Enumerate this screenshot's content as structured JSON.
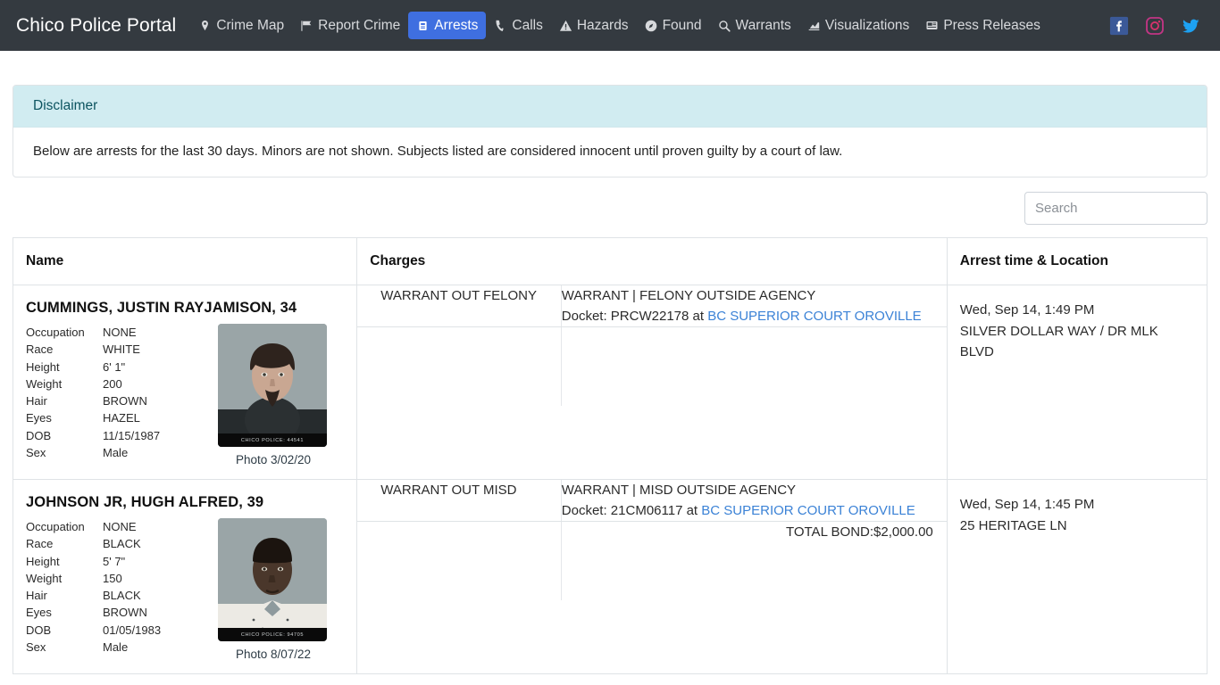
{
  "navbar": {
    "brand": "Chico Police Portal",
    "items": [
      {
        "label": "Crime Map",
        "icon": "map-pin-icon",
        "active": false
      },
      {
        "label": "Report Crime",
        "icon": "flag-icon",
        "active": false
      },
      {
        "label": "Arrests",
        "icon": "id-badge-icon",
        "active": true
      },
      {
        "label": "Calls",
        "icon": "phone-icon",
        "active": false
      },
      {
        "label": "Hazards",
        "icon": "warning-triangle-icon",
        "active": false
      },
      {
        "label": "Found",
        "icon": "compass-icon",
        "active": false
      },
      {
        "label": "Warrants",
        "icon": "search-icon",
        "active": false
      },
      {
        "label": "Visualizations",
        "icon": "bar-chart-icon",
        "active": false
      },
      {
        "label": "Press Releases",
        "icon": "news-icon",
        "active": false
      }
    ],
    "socials": [
      {
        "name": "facebook-icon",
        "color": "#3b5998"
      },
      {
        "name": "instagram-icon",
        "color": "#c13584"
      },
      {
        "name": "twitter-icon",
        "color": "#1da1f2"
      }
    ],
    "active_color": "#3f6fe0",
    "background": "#343a40"
  },
  "disclaimer": {
    "title": "Disclaimer",
    "text": "Below are arrests for the last 30 days. Minors are not shown. Subjects listed are considered innocent until proven guilty by a court of law.",
    "header_bg": "#d1ecf1",
    "header_color": "#0c5460"
  },
  "search": {
    "value": "",
    "placeholder": "Search"
  },
  "table": {
    "headers": {
      "name": "Name",
      "charges": "Charges",
      "time": "Arrest time & Location"
    },
    "attribute_labels": [
      "Occupation",
      "Race",
      "Height",
      "Weight",
      "Hair",
      "Eyes",
      "DOB",
      "Sex"
    ],
    "rows": [
      {
        "name": "CUMMINGS, JUSTIN RAYJAMISON, 34",
        "attributes": {
          "Occupation": "NONE",
          "Race": "WHITE",
          "Height": "6' 1\"",
          "Weight": "200",
          "Hair": "BROWN",
          "Eyes": "HAZEL",
          "DOB": "11/15/1987",
          "Sex": "Male"
        },
        "mugshot_stamp": "CHICO POLICE: 44541",
        "photo_date": "Photo 3/02/20",
        "charges": [
          {
            "code": "WARRANT OUT FELONY",
            "description": "WARRANT | FELONY OUTSIDE AGENCY",
            "docket_prefix": "Docket: PRCW22178 at ",
            "docket_court": "BC SUPERIOR COURT OROVILLE"
          }
        ],
        "total_bond": "",
        "arrest_time": "Wed, Sep 14, 1:49 PM",
        "arrest_location": "SILVER DOLLAR WAY / DR MLK BLVD"
      },
      {
        "name": "JOHNSON JR, HUGH ALFRED, 39",
        "attributes": {
          "Occupation": "NONE",
          "Race": "BLACK",
          "Height": "5' 7\"",
          "Weight": "150",
          "Hair": "BLACK",
          "Eyes": "BROWN",
          "DOB": "01/05/1983",
          "Sex": "Male"
        },
        "mugshot_stamp": "CHICO POLICE: 94705",
        "photo_date": "Photo 8/07/22",
        "charges": [
          {
            "code": "WARRANT OUT MISD",
            "description": "WARRANT | MISD OUTSIDE AGENCY",
            "docket_prefix": "Docket: 21CM06117 at ",
            "docket_court": "BC SUPERIOR COURT OROVILLE"
          }
        ],
        "total_bond": "TOTAL BOND:$2,000.00",
        "arrest_time": "Wed, Sep 14, 1:45 PM",
        "arrest_location": "25 HERITAGE LN"
      }
    ]
  }
}
